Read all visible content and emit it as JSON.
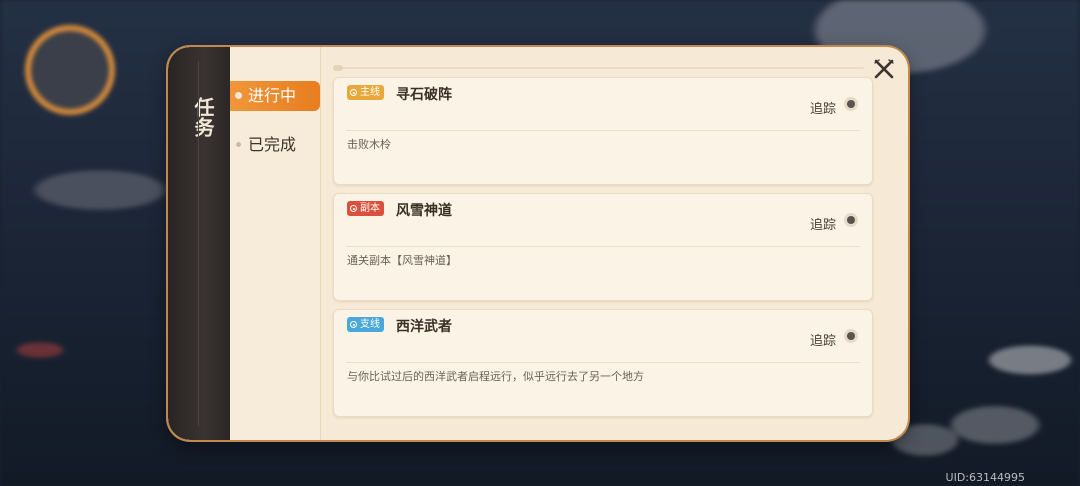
{
  "panel": {
    "title": "任务",
    "tabs": [
      {
        "label": "进行中",
        "active": true
      },
      {
        "label": "已完成",
        "active": false
      }
    ],
    "quests": [
      {
        "tag": "主线",
        "tag_color": "#e9a83a",
        "title": "寻石破阵",
        "track_label": "追踪",
        "description": "击败木柃"
      },
      {
        "tag": "副本",
        "tag_color": "#d9503c",
        "title": "风雪神道",
        "track_label": "追踪",
        "description": "通关副本【风雪神道】"
      },
      {
        "tag": "支线",
        "tag_color": "#4aa8d8",
        "title": "西洋武者",
        "track_label": "追踪",
        "description": "与你比试过后的西洋武者启程远行，似乎远行去了另一个地方"
      }
    ]
  },
  "footer": {
    "uid": "UID:63144995"
  },
  "icons": {
    "close": "close-x-icon",
    "track": "track-radio-icon",
    "tag": "target-ring-icon"
  }
}
